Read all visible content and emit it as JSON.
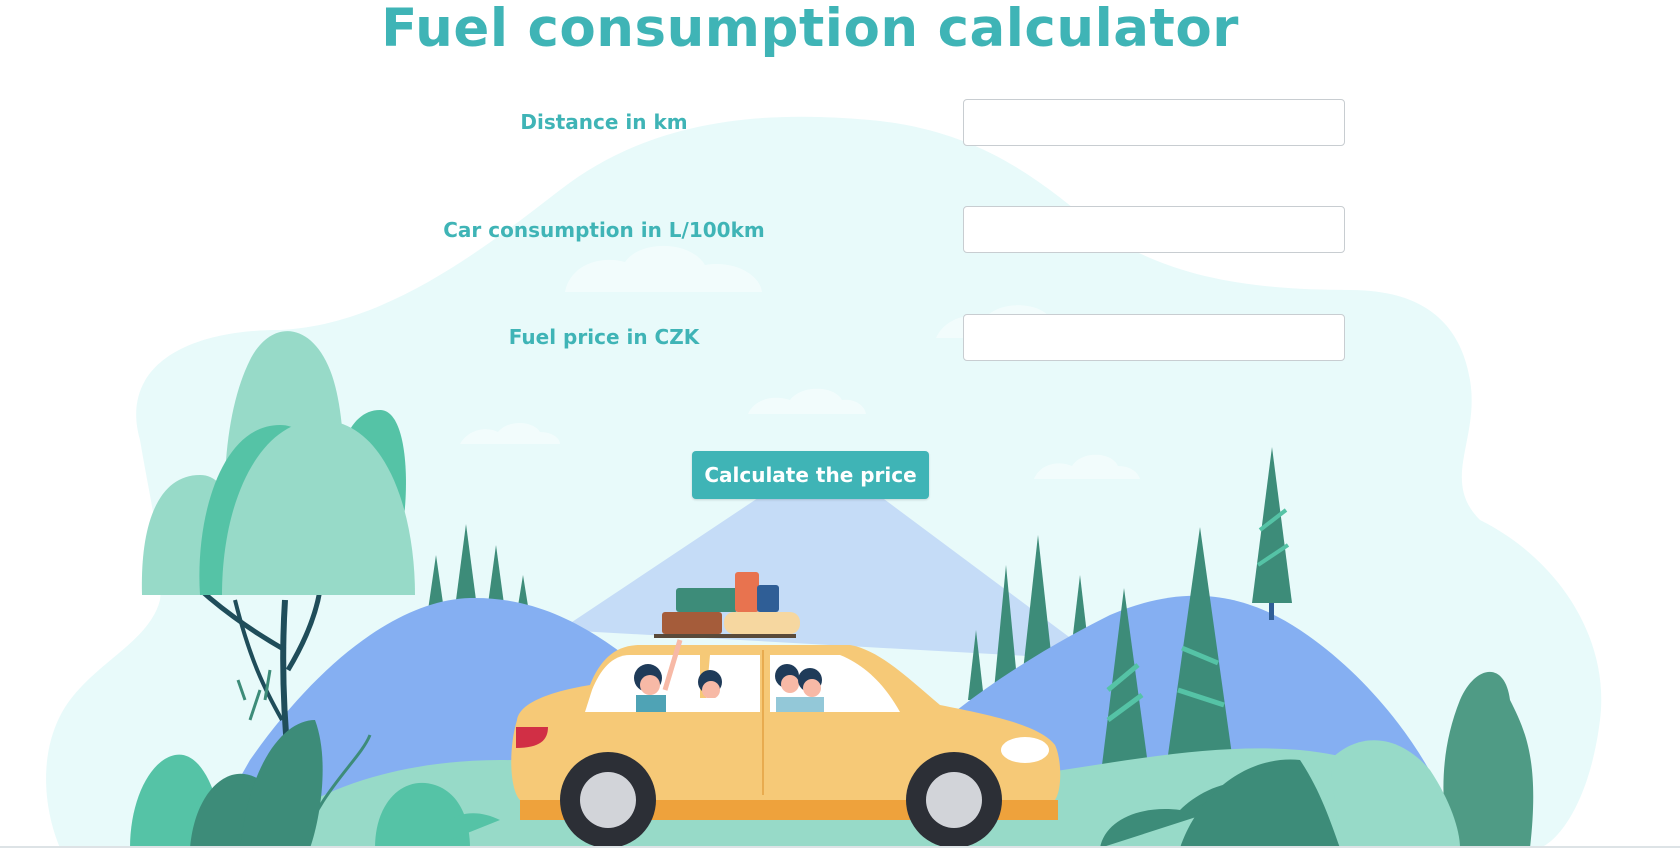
{
  "page": {
    "title": "Fuel consumption calculator"
  },
  "form": {
    "distance_label": "Distance in km",
    "distance_value": "",
    "consumption_label": "Car consumption in L/100km",
    "consumption_value": "",
    "price_label": "Fuel price in CZK",
    "price_value": "",
    "submit_label": "Calculate the price"
  },
  "colors": {
    "accent": "#3fb4b6",
    "sky": "#e8fafa",
    "mountain_far": "#c5dcf7",
    "hill_blue": "#85aff2",
    "ground": "#97dac8",
    "tree_dark": "#3d8c79",
    "car": "#f6c977"
  },
  "illustration": {
    "name": "family-road-trip-illustration"
  }
}
